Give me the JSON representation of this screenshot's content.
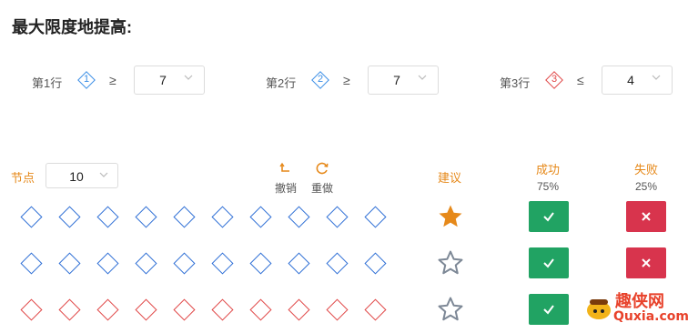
{
  "title": "最大限度地提高:",
  "rules": [
    {
      "label": "第1行",
      "badge": "1",
      "badge_color": "#3a8ee6",
      "op": "≥",
      "value": "7"
    },
    {
      "label": "第2行",
      "badge": "2",
      "badge_color": "#3a8ee6",
      "op": "≥",
      "value": "7"
    },
    {
      "label": "第3行",
      "badge": "3",
      "badge_color": "#e04646",
      "op": "≤",
      "value": "4"
    }
  ],
  "controls": {
    "node_label": "节点",
    "node_value": "10",
    "undo_label": "撤销",
    "redo_label": "重做",
    "suggest_label": "建议",
    "success_label": "成功",
    "success_pct": "75%",
    "fail_label": "失败",
    "fail_pct": "25%"
  },
  "grid_rows": [
    {
      "color": "blue",
      "nodes": 10,
      "suggest_star": "filled"
    },
    {
      "color": "blue",
      "nodes": 10,
      "suggest_star": "outline"
    },
    {
      "color": "red",
      "nodes": 10,
      "suggest_star": "outline"
    }
  ],
  "colors": {
    "accent_orange": "#e6891a",
    "node_blue": "#2f6fd6",
    "node_red": "#e04646",
    "success_green": "#21a363",
    "fail_red": "#d8344d"
  },
  "watermark": {
    "line1": "趣侠网",
    "line2": "Quxia.com"
  }
}
